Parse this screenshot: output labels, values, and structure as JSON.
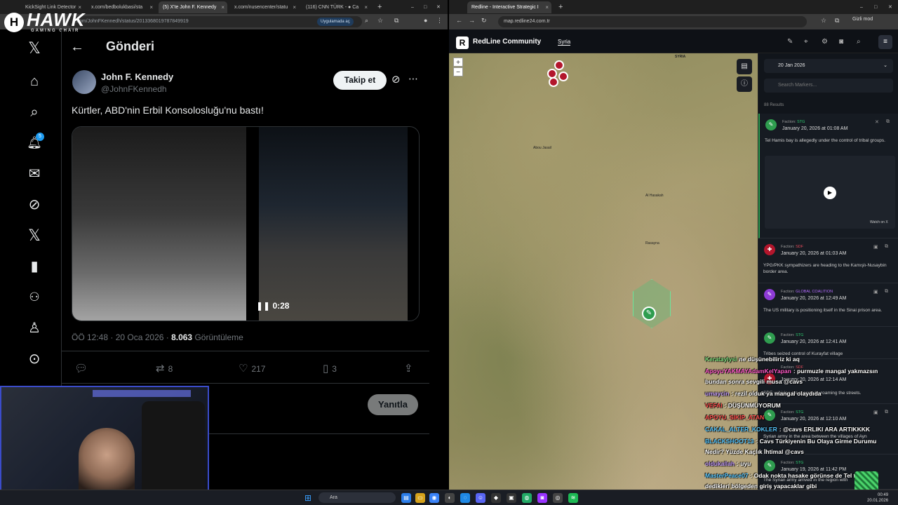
{
  "left_browser": {
    "tabs": [
      {
        "label": "KickSight Link Detector"
      },
      {
        "label": "x.com/bedbolukbasi/sta"
      },
      {
        "label": "(5) X'te John F. Kennedy"
      },
      {
        "label": "x.com/nusencenter/statu"
      },
      {
        "label": "(116) CNN TÜRK - ● Ca"
      }
    ],
    "url": "x.com/JohnFKennedh/status/2013368019787849919",
    "app_button": "Uygulamada aç"
  },
  "overlay_logo": {
    "brand": "HAWK",
    "sub": "GAMING CHAIR"
  },
  "x_nav": {
    "items": [
      {
        "name": "x-logo-icon",
        "glyph": "𝕏"
      },
      {
        "name": "home-icon",
        "glyph": "⌂"
      },
      {
        "name": "explore-icon",
        "glyph": "⌕"
      },
      {
        "name": "notifications-icon",
        "glyph": "🔔"
      },
      {
        "name": "messages-icon",
        "glyph": "✉"
      },
      {
        "name": "grok-icon",
        "glyph": "⊘"
      },
      {
        "name": "premium-icon",
        "glyph": "𝕏"
      },
      {
        "name": "bookmarks-icon",
        "glyph": "🔖"
      },
      {
        "name": "communities-icon",
        "glyph": "👥"
      },
      {
        "name": "profile-icon",
        "glyph": "👤"
      },
      {
        "name": "more-icon",
        "glyph": "⋯"
      }
    ],
    "notification_count": "5"
  },
  "post": {
    "header_title": "Gönderi",
    "author_name": "John F. Kennedy",
    "author_handle": "@JohnFKennedh",
    "follow_label": "Takip et",
    "text": "Kürtler, ABD'nin Erbil Konsolosluğu'nu bastı!",
    "video_time": "0:28",
    "timestamp": "ÖÖ 12:48 · 20 Oca 2026 · ",
    "views": "8.063",
    "views_label": " Görüntüleme",
    "retweets": "8",
    "likes": "217",
    "bookmarks": "3",
    "reply_label": "Yanıtla"
  },
  "right_browser": {
    "tab": "Redline - Interactive Strategic I",
    "url": "map.redline24.com.tr",
    "incognito": "Gizli mod"
  },
  "redline": {
    "title": "RedLine Community",
    "region": "Syria",
    "date": "20 Jan 2026",
    "search_placeholder": "Search Markers...",
    "results": "88 Results",
    "map_labels": [
      "SYRIA",
      "Abou Jasail",
      "Al Hasakah",
      "Rasayna"
    ],
    "cards": [
      {
        "faction_label": "Faction:",
        "faction": "STG",
        "date": "January 20, 2026 at 01:08 AM",
        "text": "Tel Hamis bay is allegedly under the control of tribal groups.",
        "watch": "Watch on X",
        "color": "#2f9d4f"
      },
      {
        "faction_label": "Faction:",
        "faction": "SDF",
        "date": "January 20, 2026 at 01:03 AM",
        "text": "YPG/PKK sympathizers are heading to the Kamışlı-Nusaybin border area.",
        "color": "#b3162c"
      },
      {
        "faction_label": "Faction:",
        "faction": "GLOBAL COALITION",
        "date": "January 20, 2026 at 12:49 AM",
        "text": "The US military is positioning itself in the Sinai prison area.",
        "color": "#8e3bd6"
      },
      {
        "faction_label": "Faction:",
        "faction": "STG",
        "date": "January 20, 2026 at 12:41 AM",
        "text": "Tribes seized control of Kurayfat village",
        "color": "#2f9d4f"
      },
      {
        "faction_label": "Faction:",
        "faction": "SDF",
        "date": "January 20, 2026 at 12:14 AM",
        "text": "SDF vehicles are reportedly roaming the streets.",
        "color": "#b3162c"
      },
      {
        "faction_label": "Faction:",
        "faction": "STG",
        "date": "January 20, 2026 at 12:10 AM",
        "text": "Syrian army in the area between the villages of Ayn",
        "color": "#2f9d4f"
      },
      {
        "faction_label": "Faction:",
        "faction": "STG",
        "date": "January 19, 2026 at 11:42 PM",
        "text": "The Syrian army arrived in the region with",
        "color": "#2f9d4f"
      }
    ]
  },
  "chat": [
    {
      "user": "Kerataylysi",
      "msg": "ne düşünebiliriz ki aq",
      "color": "#7ee07e"
    },
    {
      "user": "ApoyuYAKMAYAdamKelYapan",
      "msg": ": purmuzle mangal yakmazsın",
      "color": "#ff5ac8"
    },
    {
      "user": "",
      "msg": "bundan sonra sevgili musa @cavs",
      "color": "#ffffff"
    },
    {
      "user": "umaycin",
      "msg": ": rezil olduk ya mangal olaydıda",
      "color": "#c7a0ff"
    },
    {
      "user": "VEFAI",
      "msg": ": DÜŞÜNMÜYORUM",
      "color": "#ff4d4d"
    },
    {
      "user": "APOYU_SIKIP_ATAN",
      "msg": "",
      "color": "#ff4d4d"
    },
    {
      "user": "CAKAL_ALTER_KOKLER",
      "msg": ": @cavs ERLIKI ARA ARTIKKKK",
      "color": "#57c7ff"
    },
    {
      "user": "BLACKSHOOT13",
      "msg": ": Cavs Türkiyenin Bu Olaya Girme Durumu",
      "color": "#57c7ff"
    },
    {
      "user": "",
      "msg": "Nedir? Yüzde Kaçlık İhtimal @cavs",
      "color": "#ffffff"
    },
    {
      "user": "oldukallah",
      "msg": ": uyu",
      "color": "#c7a0ff"
    },
    {
      "user": "MasterPeace07",
      "msg": ": Odak nokta hasake görünse de Tel tamer",
      "color": "#57c7ff"
    },
    {
      "user": "",
      "msg": "dedikleri bölgeden giriş yapacaklar gibi",
      "color": "#ffffff"
    }
  ],
  "taskbar": {
    "search": "Ara",
    "clock_time": "00:49",
    "clock_date": "20.01.2026"
  }
}
